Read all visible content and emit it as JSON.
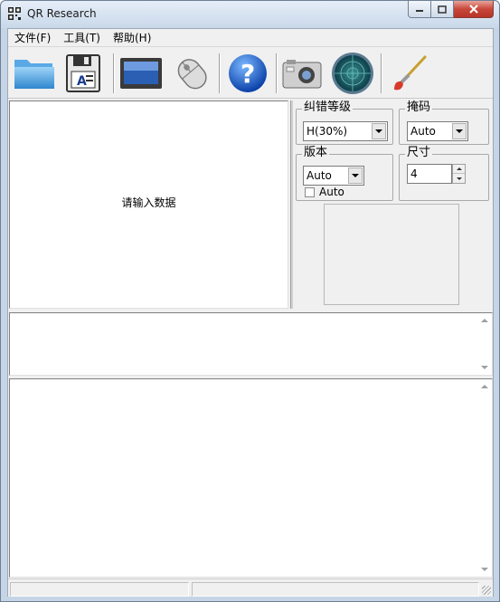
{
  "window": {
    "title": "QR Research"
  },
  "menu": {
    "items": [
      "文件(F)",
      "工具(T)",
      "帮助(H)"
    ]
  },
  "toolbar": {
    "buttons": [
      {
        "icon": "open-folder-icon"
      },
      {
        "icon": "save-disk-icon"
      },
      {
        "icon": "monitor-icon"
      },
      {
        "icon": "mouse-icon"
      },
      {
        "icon": "help-icon"
      },
      {
        "icon": "camera-icon"
      },
      {
        "icon": "radar-scan-icon"
      },
      {
        "icon": "brush-icon"
      }
    ]
  },
  "input": {
    "placeholder": "请输入数据"
  },
  "options": {
    "ecc": {
      "label": "纠错等级",
      "value": "H(30%)"
    },
    "mask": {
      "label": "掩码",
      "value": "Auto"
    },
    "version": {
      "label": "版本",
      "value": "Auto",
      "checkbox_label": "Auto",
      "checked": false
    },
    "size": {
      "label": "尺寸",
      "value": "4"
    }
  },
  "colors": {
    "accent": "#1f6fd1",
    "window_frame": "#c6d5e6",
    "close_red": "#c8473a"
  }
}
